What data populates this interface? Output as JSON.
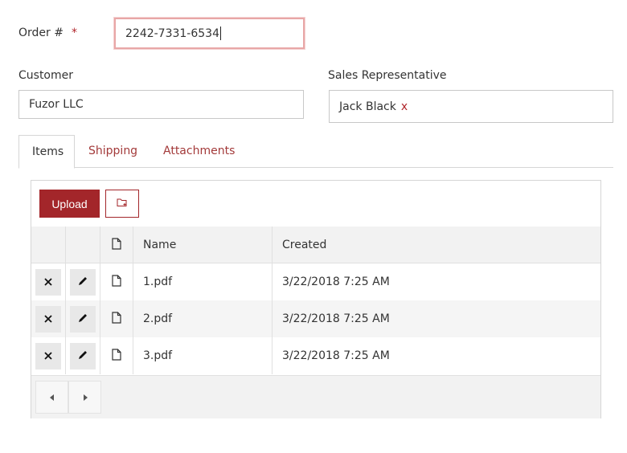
{
  "order": {
    "label": "Order #",
    "required_mark": "*",
    "value": "2242-7331-6534"
  },
  "customer": {
    "label": "Customer",
    "value": "Fuzor LLC"
  },
  "sales_rep": {
    "label": "Sales Representative",
    "value": "Jack Black",
    "remove": "x"
  },
  "tabs": [
    {
      "label": "Items",
      "active": true
    },
    {
      "label": "Shipping",
      "active": false
    },
    {
      "label": "Attachments",
      "active": false
    }
  ],
  "toolbar": {
    "upload_label": "Upload",
    "folder_icon": "folder-add-icon"
  },
  "table": {
    "columns": [
      "",
      "",
      "file-icon",
      "Name",
      "Created"
    ],
    "rows": [
      {
        "name": "1.pdf",
        "created": "3/22/2018 7:25 AM"
      },
      {
        "name": "2.pdf",
        "created": "3/22/2018 7:25 AM"
      },
      {
        "name": "3.pdf",
        "created": "3/22/2018 7:25 AM"
      }
    ]
  },
  "colors": {
    "accent": "#a3262a",
    "link": "#a33a3a",
    "focus_border": "#e8a7a7"
  }
}
